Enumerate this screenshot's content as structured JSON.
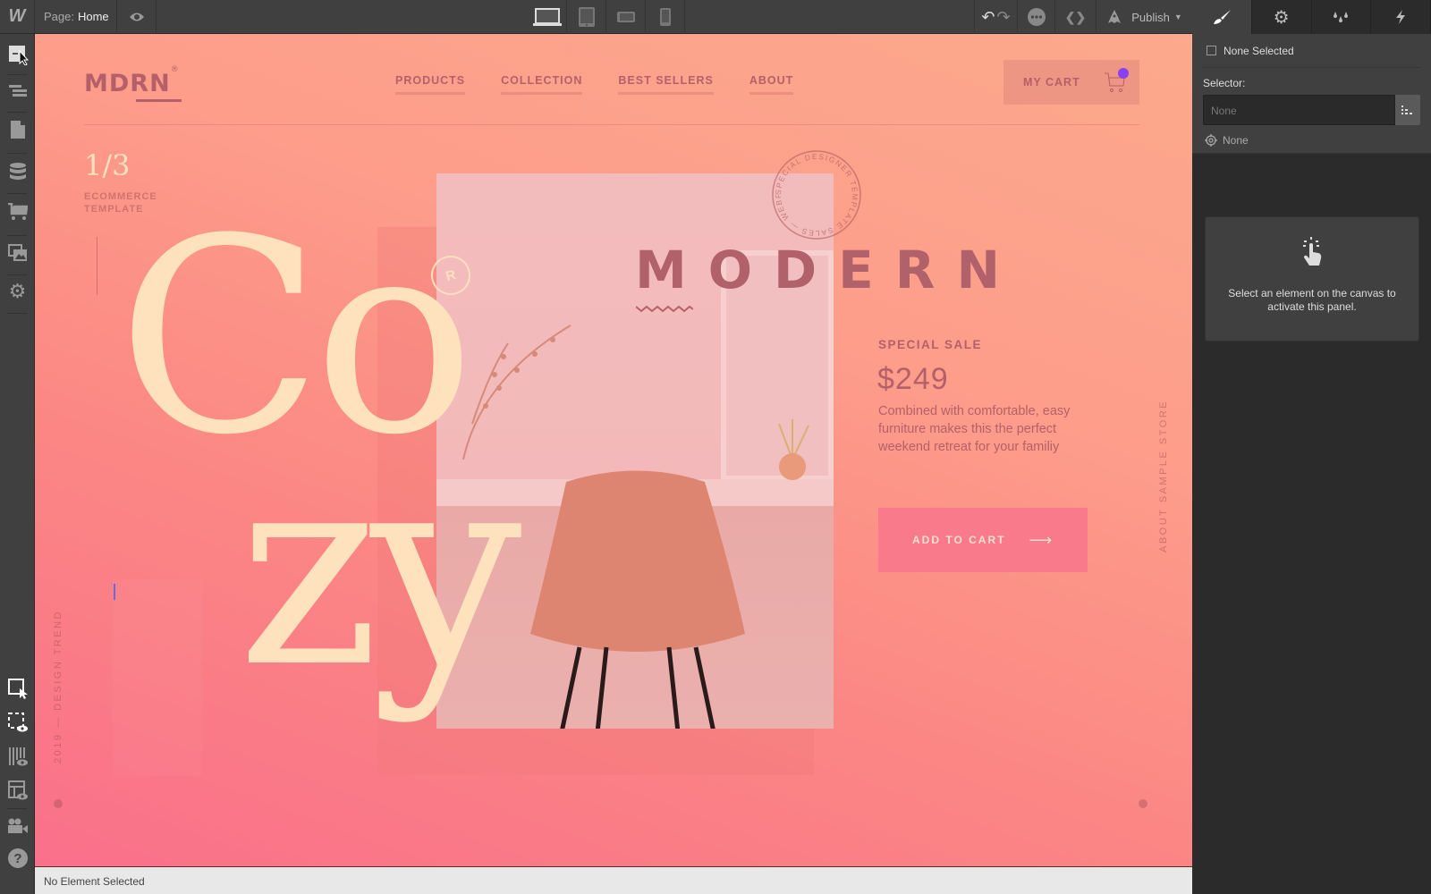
{
  "topbar": {
    "logo": "W",
    "page_key": "Page:",
    "page_value": "Home",
    "publish_label": "Publish",
    "icons": [
      "webflow-logo",
      "preview-eye-icon",
      "desktop-icon",
      "tablet-icon",
      "mobile-landscape-icon",
      "mobile-portrait-icon",
      "undo-icon",
      "redo-icon",
      "more-icon",
      "code-icon",
      "rocket-icon"
    ]
  },
  "panel_tabs": [
    "style-brush-icon",
    "settings-gear-icon",
    "interactions-drops-icon",
    "lightning-icon"
  ],
  "leftbar": {
    "top_icons": [
      "add-element-icon",
      "navigator-icon",
      "pages-icon",
      "cms-icon",
      "ecommerce-cart-icon",
      "assets-icon",
      "settings-icon"
    ],
    "bottom_icons": [
      "select-element-icon",
      "preview-box-icon",
      "grid-preview-icon",
      "layout-preview-icon",
      "video-tutorials-icon",
      "help-icon"
    ]
  },
  "right_panel": {
    "none_selected": "None Selected",
    "selector_label": "Selector:",
    "selector_placeholder": "None",
    "state_value": "None",
    "hint_text_line1": "Select an element on the canvas to",
    "hint_text_line2": "activate this panel."
  },
  "statusbar": {
    "text": "No Element Selected"
  },
  "site": {
    "logo": "MDRN",
    "logo_reg": "®",
    "nav": [
      "PRODUCTS",
      "COLLECTION",
      "BEST SELLERS",
      "ABOUT"
    ],
    "cart_label": "MY CART",
    "slide_counter": "1/3",
    "template_label_1": "ECOMMERCE",
    "template_label_2": "TEMPLATE",
    "hero_word_1": "Co",
    "hero_word_2": "zy",
    "badge": "R",
    "stamp_text": "SPECIAL DESIGNER TEMPLATE SALES — WEBFLOW ",
    "headline": "MODERN",
    "sale_label": "SPECIAL SALE",
    "price": "$249",
    "description": "Combined with comfortable, easy furniture makes this the perfect weekend retreat for your familiy",
    "cta_label": "ADD TO CART",
    "cta_arrow": "⟶",
    "side_right": "ABOUT SAMPLE STORE",
    "side_left": "2019 — DESIGN TREND"
  },
  "colors": {
    "accent_text": "#b56069",
    "cream": "#fde2bd",
    "cta_bg": "#f97a8b",
    "cart_dot": "#8b3ff5"
  }
}
